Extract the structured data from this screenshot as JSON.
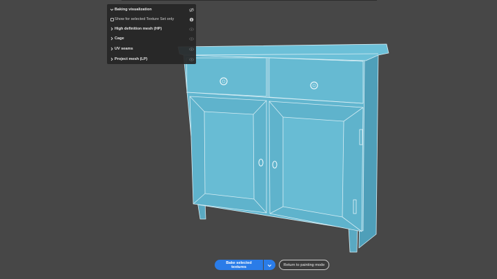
{
  "panel": {
    "title": "Baking visualization",
    "show_selected_label": "Show for selected Texture Set only",
    "items": [
      {
        "label": "High definition mesh (HP)"
      },
      {
        "label": "Cage"
      },
      {
        "label": "UV seams"
      },
      {
        "label": "Project mesh (LP)"
      }
    ]
  },
  "actions": {
    "bake_label": "Bake selected textures",
    "return_label": "Return to painting mode"
  },
  "colors": {
    "background": "#474747",
    "mesh": "#5fb3cc",
    "accent": "#2a7ce8"
  }
}
